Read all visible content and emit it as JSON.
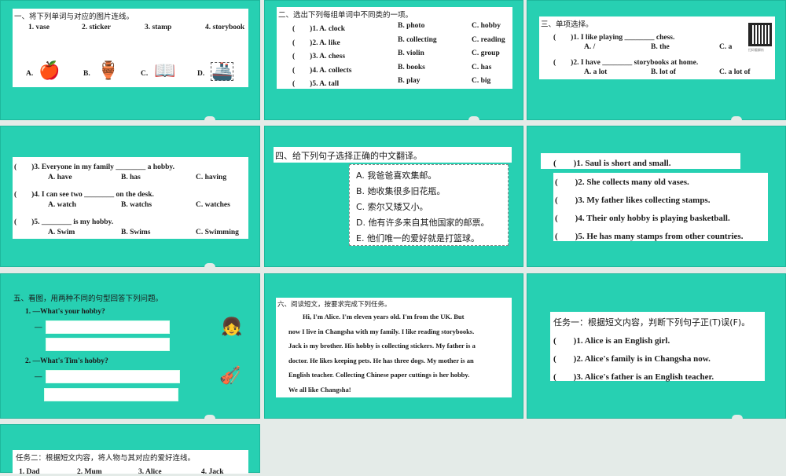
{
  "slide1": {
    "title": "一、将下列单词与对应的图片连线。",
    "words": [
      "1. vase",
      "2. sticker",
      "3. stamp",
      "4. storybook"
    ],
    "pictures": [
      "A.",
      "B.",
      "C.",
      "D."
    ]
  },
  "slide2": {
    "title": "二、选出下列每组单词中不同类的一项。",
    "rows": [
      {
        "q": "(　　)1. A. clock",
        "b": "B. photo",
        "c": "C. hobby"
      },
      {
        "q": "(　　)2. A. like",
        "b": "B. collecting",
        "c": "C. reading"
      },
      {
        "q": "(　　)3. A. chess",
        "b": "B. violin",
        "c": "C. group"
      },
      {
        "q": "(　　)4. A. collects",
        "b": "B. books",
        "c": "C. has"
      },
      {
        "q": "(　　)5. A. tall",
        "b": "B. play",
        "c": "C. big"
      }
    ]
  },
  "slide3": {
    "title": "三、单项选择。",
    "qr_caption": "扫码看解析",
    "items": [
      {
        "q": "(　　)1. I like playing ________ chess.",
        "a": "A. /",
        "b": "B. the",
        "c": "C. a"
      },
      {
        "q": "(　　)2. I have ________ storybooks at home.",
        "a": "A. a lot",
        "b": "B. lot of",
        "c": "C. a lot of"
      }
    ]
  },
  "slide4": {
    "items": [
      {
        "q": "(　　)3. Everyone in my family ________ a hobby.",
        "a": "A. have",
        "b": "B. has",
        "c": "C. having"
      },
      {
        "q": "(　　)4. I can see two ________ on the desk.",
        "a": "A. watch",
        "b": "B. watchs",
        "c": "C. watches"
      },
      {
        "q": "(　　)5. ________ is my hobby.",
        "a": "A. Swim",
        "b": "B. Swims",
        "c": "C. Swimming"
      }
    ]
  },
  "slide5": {
    "title": "四、给下列句子选择正确的中文翻译。",
    "options": [
      "A. 我爸爸喜欢集邮。",
      "B. 她收集很多旧花瓶。",
      "C. 索尔又矮又小。",
      "D. 他有许多来自其他国家的邮票。",
      "E. 他们唯一的爱好就是打篮球。"
    ]
  },
  "slide6": {
    "items": [
      "(　　)1. Saul is short and small.",
      "(　　)2. She collects many old vases.",
      "(　　)3. My father likes collecting stamps.",
      "(　　)4. Their only hobby is playing basketball.",
      "(　　)5. He has many stamps from other countries."
    ]
  },
  "slide7": {
    "title": "五、看图，用两种不同的句型回答下列问题。",
    "q1": "1. —What's your hobby?",
    "q2": "2. —What's Tim's hobby?",
    "dash": "—"
  },
  "slide8": {
    "title": "六、阅读短文，按要求完成下列任务。",
    "lines": [
      "Hi, I'm Alice. I'm eleven years old. I'm from the UK. But",
      "now I live in Changsha with my family. I like reading storybooks.",
      "Jack is my brother. His hobby is collecting stickers. My father is a",
      "doctor. He likes keeping pets. He has three dogs. My mother is an",
      "English teacher. Collecting Chinese paper cuttings is her hobby.",
      "We all like Changsha!"
    ]
  },
  "slide9": {
    "title": "任务一：根据短文内容，判断下列句子正(T)误(F)。",
    "items": [
      "(　　)1. Alice is an English girl.",
      "(　　)2. Alice's family is in Changsha now.",
      "(　　)3. Alice's father is an English teacher."
    ]
  },
  "slide10": {
    "title": "任务二：根据短文内容，将人物与其对应的爱好连线。",
    "people": [
      "1. Dad",
      "2. Mum",
      "3. Alice",
      "4. Jack"
    ]
  }
}
